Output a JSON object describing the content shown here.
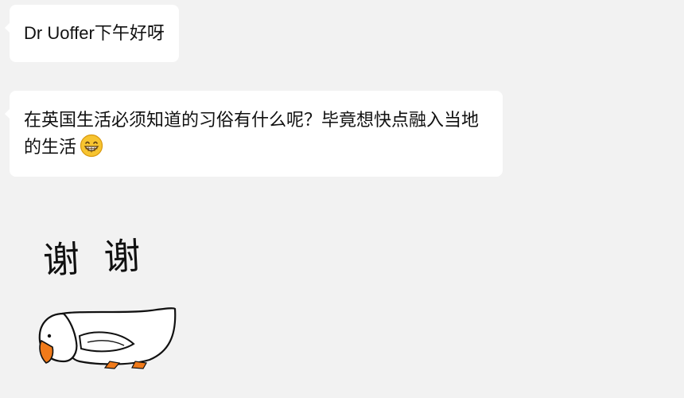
{
  "messages": [
    {
      "text": "Dr Uoffer下午好呀"
    },
    {
      "text": "在英国生活必须知道的习俗有什么呢？毕竟想快点融入当地的生活"
    }
  ],
  "sticker": {
    "caption": "谢 谢",
    "description_icon": "bowing-goose-icon"
  },
  "colors": {
    "background": "#f2f2f2",
    "bubble": "#ffffff",
    "text": "#111111",
    "emoji_face": "#f7c430",
    "goose_beak": "#f07a1a"
  }
}
